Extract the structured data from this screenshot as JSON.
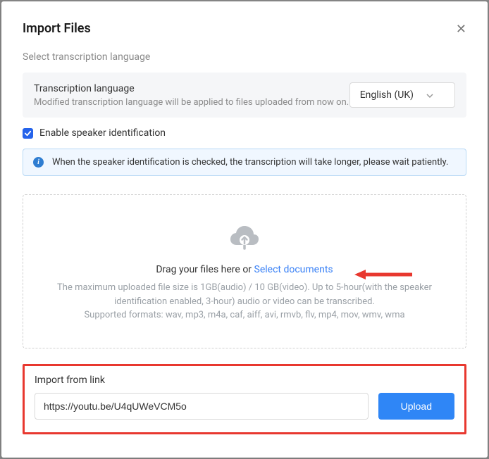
{
  "header": {
    "title": "Import Files"
  },
  "subtitle": "Select transcription language",
  "lang": {
    "label": "Transcription language",
    "help": "Modified transcription language will be applied to files uploaded from now on.",
    "selected": "English (UK)"
  },
  "speaker": {
    "label": "Enable speaker identification",
    "checked": true
  },
  "info": "When the speaker identification is checked, the transcription will take longer, please wait patiently.",
  "dropzone": {
    "text_prefix": "Drag your files here or  ",
    "link_text": "Select documents",
    "limits_line1": "The maximum uploaded file size is 1GB(audio) / 10 GB(video). Up to 5-hour(with the speaker identification enabled, 3-hour) audio or video can be transcribed.",
    "limits_line2": "Supported formats: wav, mp3, m4a, caf, aiff, avi, rmvb, flv, mp4, mov, wmv, wma"
  },
  "import": {
    "label": "Import from link",
    "url": "https://youtu.be/U4qUWeVCM5o",
    "button": "Upload"
  }
}
